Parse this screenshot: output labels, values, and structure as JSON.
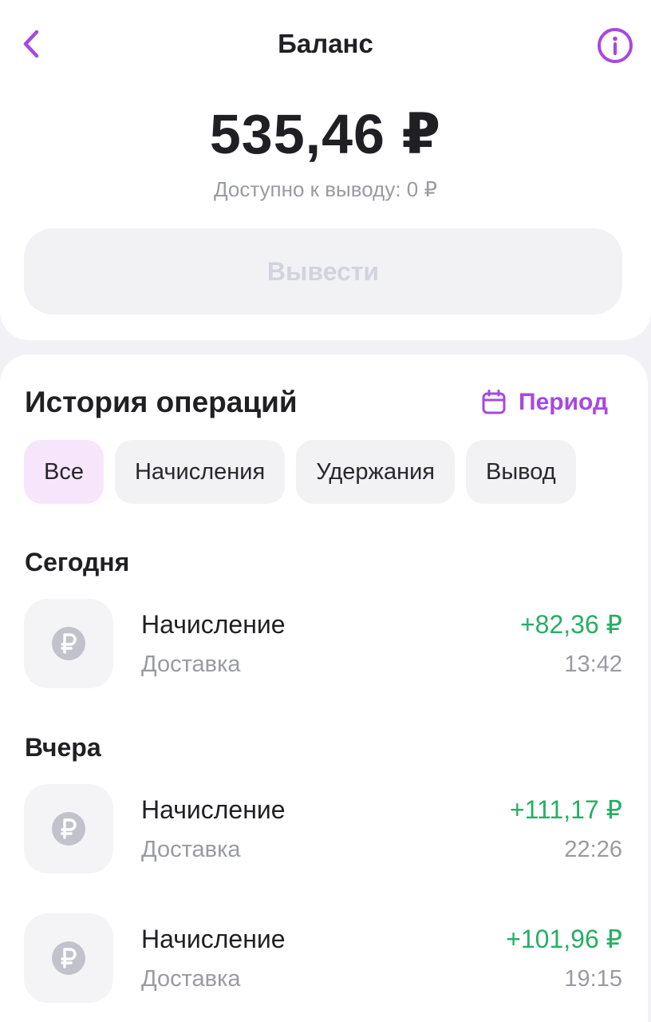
{
  "header": {
    "title": "Баланс"
  },
  "balance": {
    "amount": "535,46 ₽",
    "available": "Доступно к выводу: 0 ₽",
    "withdraw_label": "Вывести"
  },
  "history": {
    "title": "История операций",
    "period_label": "Период",
    "filters": [
      {
        "label": "Все",
        "active": true
      },
      {
        "label": "Начисления",
        "active": false
      },
      {
        "label": "Удержания",
        "active": false
      },
      {
        "label": "Вывод",
        "active": false
      }
    ],
    "groups": [
      {
        "label": "Сегодня",
        "items": [
          {
            "title": "Начисление",
            "subtitle": "Доставка",
            "amount": "+82,36 ₽",
            "time": "13:42"
          }
        ]
      },
      {
        "label": "Вчера",
        "items": [
          {
            "title": "Начисление",
            "subtitle": "Доставка",
            "amount": "+111,17 ₽",
            "time": "22:26"
          },
          {
            "title": "Начисление",
            "subtitle": "Доставка",
            "amount": "+101,96 ₽",
            "time": "19:15"
          }
        ]
      }
    ]
  },
  "colors": {
    "accent": "#a748e0",
    "positive": "#27ae64",
    "muted": "#9a9aa3",
    "icon_gray": "#c2c2cc"
  }
}
